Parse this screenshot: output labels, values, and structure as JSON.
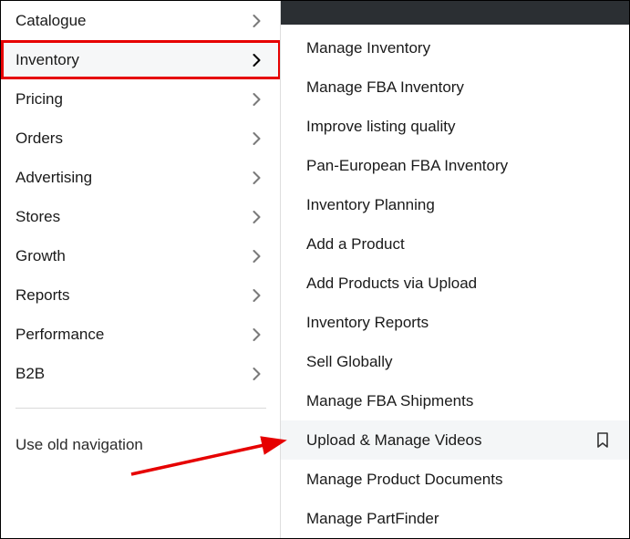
{
  "sidebar": {
    "items": [
      {
        "label": "Catalogue",
        "active": false,
        "highlighted": false
      },
      {
        "label": "Inventory",
        "active": true,
        "highlighted": true
      },
      {
        "label": "Pricing",
        "active": false,
        "highlighted": false
      },
      {
        "label": "Orders",
        "active": false,
        "highlighted": false
      },
      {
        "label": "Advertising",
        "active": false,
        "highlighted": false
      },
      {
        "label": "Stores",
        "active": false,
        "highlighted": false
      },
      {
        "label": "Growth",
        "active": false,
        "highlighted": false
      },
      {
        "label": "Reports",
        "active": false,
        "highlighted": false
      },
      {
        "label": "Performance",
        "active": false,
        "highlighted": false
      },
      {
        "label": "B2B",
        "active": false,
        "highlighted": false
      }
    ],
    "old_nav_link": "Use old navigation"
  },
  "submenu": {
    "items": [
      {
        "label": "Manage Inventory",
        "hover": false
      },
      {
        "label": "Manage FBA Inventory",
        "hover": false
      },
      {
        "label": "Improve listing quality",
        "hover": false
      },
      {
        "label": "Pan-European FBA Inventory",
        "hover": false
      },
      {
        "label": "Inventory Planning",
        "hover": false
      },
      {
        "label": "Add a Product",
        "hover": false
      },
      {
        "label": "Add Products via Upload",
        "hover": false
      },
      {
        "label": "Inventory Reports",
        "hover": false
      },
      {
        "label": "Sell Globally",
        "hover": false
      },
      {
        "label": "Manage FBA Shipments",
        "hover": false
      },
      {
        "label": "Upload & Manage Videos",
        "hover": true
      },
      {
        "label": "Manage Product Documents",
        "hover": false
      },
      {
        "label": "Manage PartFinder",
        "hover": false
      }
    ]
  },
  "annotation": {
    "highlight_color": "#e60000",
    "arrow_color": "#e60000"
  }
}
